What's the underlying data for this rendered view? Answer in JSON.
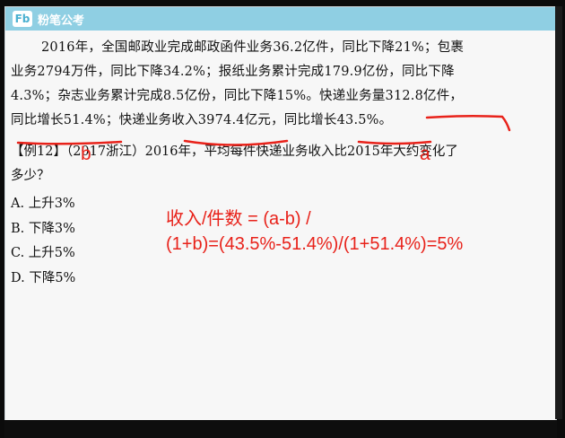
{
  "app": {
    "logo_mark": "Fb",
    "logo_text": "粉笔公考"
  },
  "passage": {
    "line1": "2016年，全国邮政业完成邮政函件业务36.2亿件，同比下降21%；包裹",
    "line2": "业务2794万件，同比下降34.2%；报纸业务累计完成179.9亿份，同比下降",
    "line3": "4.3%；杂志业务累计完成8.5亿份，同比下降15%。快递业务量312.8亿件，",
    "line4": "同比增长51.4%；快递业务收入3974.4亿元，同比增长43.5%。"
  },
  "question": {
    "line1": "【例12】（2017浙江）2016年，平均每件快递业务收入比2015年大约变化了",
    "line2": "多少？"
  },
  "options": [
    "A. 上升3%",
    "B. 下降3%",
    "C. 上升5%",
    "D. 下降5%"
  ],
  "annotations": {
    "label_b": "b",
    "label_a": "a",
    "formula_line1": "收入/件数 =  (a-b) /",
    "formula_line2": "(1+b)=(43.5%-51.4%)/(1+51.4%)=5%"
  },
  "colors": {
    "ink": "#e8221a",
    "header": "#8fcfe3"
  }
}
